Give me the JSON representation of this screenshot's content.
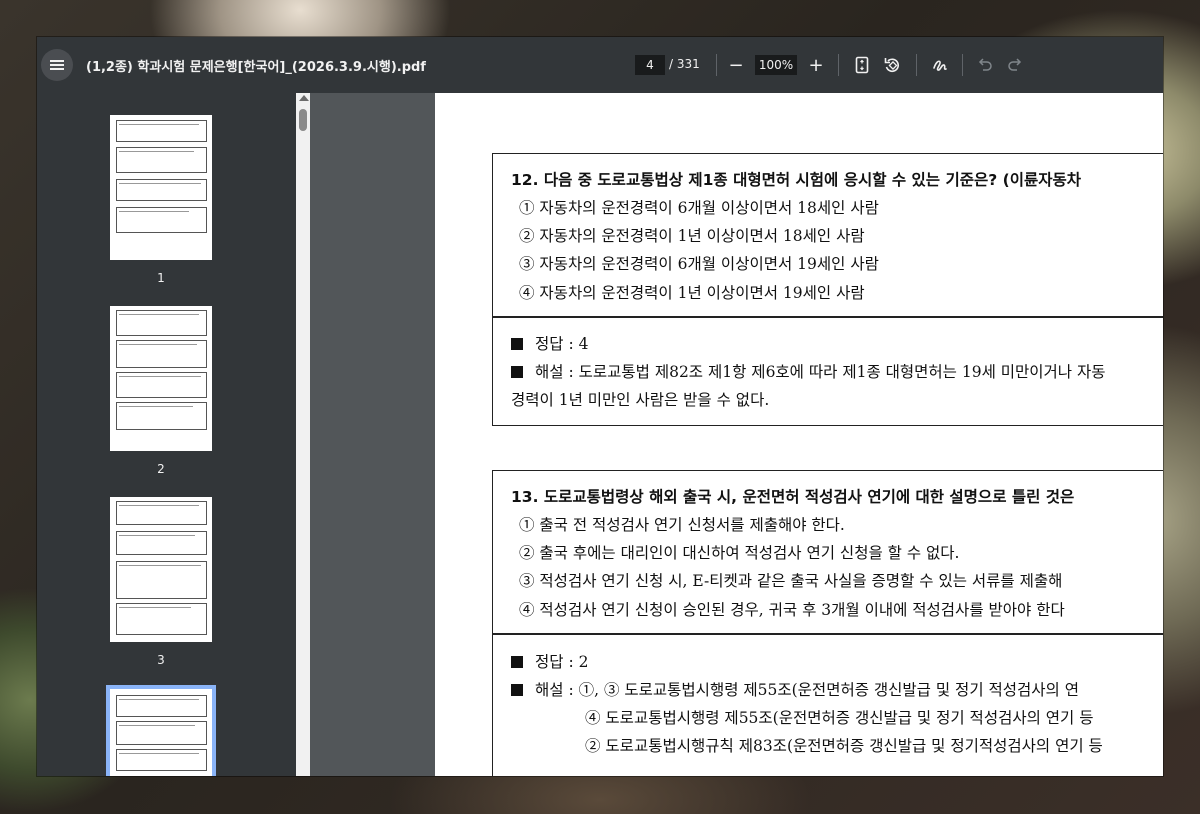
{
  "toolbar": {
    "title": "(1,2종) 학과시험 문제은행[한국어]_(2026.3.9.시행).pdf",
    "current_page": "4",
    "total_pages": "/ 331",
    "zoom_out": "−",
    "zoom": "100%",
    "zoom_in": "+"
  },
  "sidebar": {
    "thumbnails": [
      {
        "number": "1"
      },
      {
        "number": "2"
      },
      {
        "number": "3"
      }
    ]
  },
  "document": {
    "q12": {
      "question": "12. 다음 중 도로교통법상 제1종 대형면허 시험에 응시할 수 있는 기준은? (이륜자동차",
      "options": [
        "① 자동차의 운전경력이 6개월 이상이면서 18세인 사람",
        "② 자동차의 운전경력이 1년 이상이면서 18세인 사람",
        "③ 자동차의 운전경력이 6개월 이상이면서 19세인 사람",
        "④ 자동차의 운전경력이 1년 이상이면서 19세인 사람"
      ],
      "answer": "정답 : 4",
      "explanation_1": "해설 : 도로교통법 제82조 제1항 제6호에 따라 제1종 대형면허는 19세 미만이거나 자동",
      "explanation_2": "경력이 1년 미만인 사람은 받을 수 없다."
    },
    "q13": {
      "question": "13. 도로교통법령상 해외 출국 시, 운전면허 적성검사 연기에 대한 설명으로 틀린 것은",
      "options": [
        "① 출국 전 적성검사 연기 신청서를 제출해야 한다.",
        "② 출국 후에는 대리인이 대신하여 적성검사 연기 신청을 할 수 없다.",
        "③ 적성검사 연기 신청 시, E-티켓과 같은 출국 사실을 증명할 수 있는 서류를 제출해",
        "④ 적성검사 연기 신청이 승인된 경우, 귀국 후 3개월 이내에 적성검사를 받아야 한다"
      ],
      "answer": "정답 : 2",
      "explanation_1": "해설 : ①, ③ 도로교통법시행령 제55조(운전면허증 갱신발급 및 정기 적성검사의 연",
      "explanation_2": "④ 도로교통법시행령 제55조(운전면허증 갱신발급 및 정기 적성검사의 연기 등",
      "explanation_3": "② 도로교통법시행규칙 제83조(운전면허증 갱신발급 및 정기적성검사의 연기 등"
    }
  }
}
